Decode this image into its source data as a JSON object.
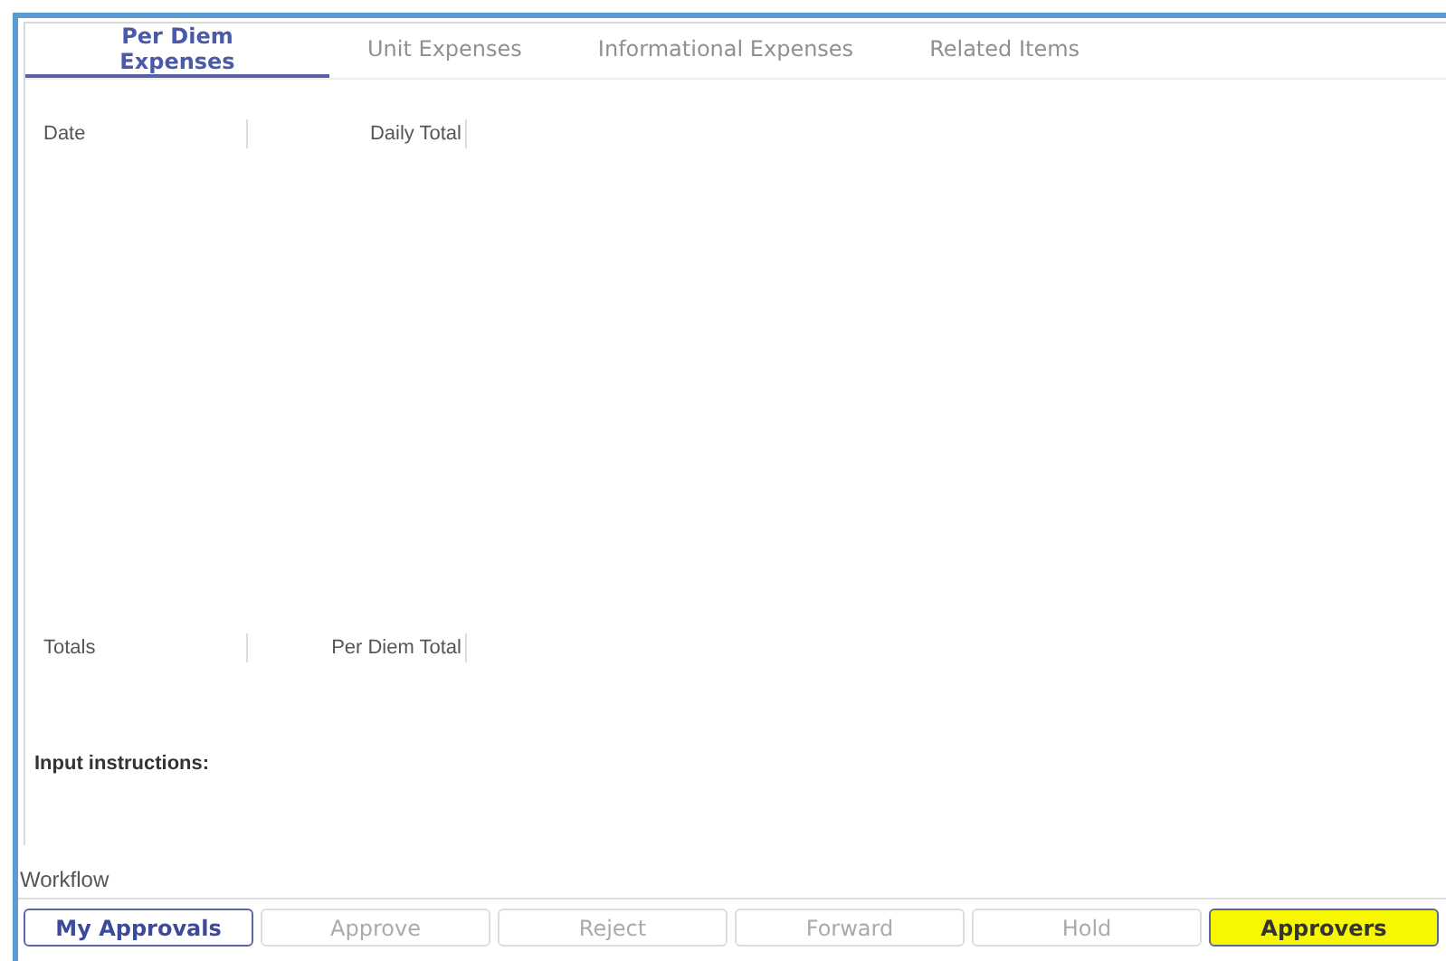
{
  "tabs": [
    {
      "label": "Per Diem Expenses",
      "selected": true
    },
    {
      "label": "Unit Expenses",
      "selected": false
    },
    {
      "label": "Informational Expenses",
      "selected": false
    },
    {
      "label": "Related Items",
      "selected": false
    }
  ],
  "table": {
    "columns": [
      "Date",
      "Daily Total"
    ]
  },
  "totals": {
    "columns": [
      "Totals",
      "Per Diem Total"
    ]
  },
  "input_instructions": "Input instructions:",
  "workflow": {
    "title": "Workflow",
    "buttons": [
      {
        "label": "My Approvals",
        "disabled": false,
        "highlighted": false
      },
      {
        "label": "Approve",
        "disabled": true,
        "highlighted": false
      },
      {
        "label": "Reject",
        "disabled": true,
        "highlighted": false
      },
      {
        "label": "Forward",
        "disabled": true,
        "highlighted": false
      },
      {
        "label": "Hold",
        "disabled": true,
        "highlighted": false
      },
      {
        "label": "Approvers",
        "disabled": false,
        "highlighted": true
      }
    ]
  }
}
